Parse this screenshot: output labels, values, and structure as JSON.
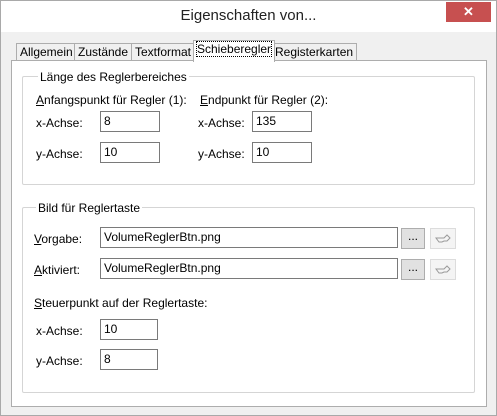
{
  "window": {
    "title": "Eigenschaften von...",
    "close_glyph": "✕"
  },
  "tabs": [
    {
      "label": "Allgemein",
      "active": false
    },
    {
      "label": "Zustände",
      "active": false
    },
    {
      "label": "Textformat",
      "active": false
    },
    {
      "label": "Schieberegler",
      "active": true
    },
    {
      "label": "Registerkarten",
      "active": false
    }
  ],
  "range_group": {
    "title": "Länge des Reglerbereiches",
    "start_label": "Anfangspunkt  für Regler (1):",
    "start_mnemonic": "A",
    "start_rest": "nfangspunkt  für Regler (1):",
    "end_mnemonic": "E",
    "end_rest": "ndpunkt für Regler (2):",
    "start_x_label": "x-Achse:",
    "start_x_value": "8",
    "start_y_label": "y-Achse:",
    "start_y_value": "10",
    "end_x_label": "x-Achse:",
    "end_x_value": "135",
    "end_y_label": "y-Achse:",
    "end_y_value": "10"
  },
  "image_group": {
    "title": "Bild für Reglertaste",
    "default_mnemonic": "V",
    "default_rest": "orgabe:",
    "default_value": "VolumeReglerBtn.png",
    "activated_mnemonic": "A",
    "activated_rest": "ktiviert:",
    "activated_value": "VolumeReglerBtn.png",
    "browse_label": "...",
    "control_point_mnemonic": "S",
    "control_point_rest": "teuerpunkt auf der Reglertaste:",
    "cp_x_label": "x-Achse:",
    "cp_x_value": "10",
    "cp_y_label": "y-Achse:",
    "cp_y_value": "8"
  },
  "colors": {
    "close_button": "#c75050",
    "panel": "#ffffff",
    "window": "#f0f0f0"
  }
}
